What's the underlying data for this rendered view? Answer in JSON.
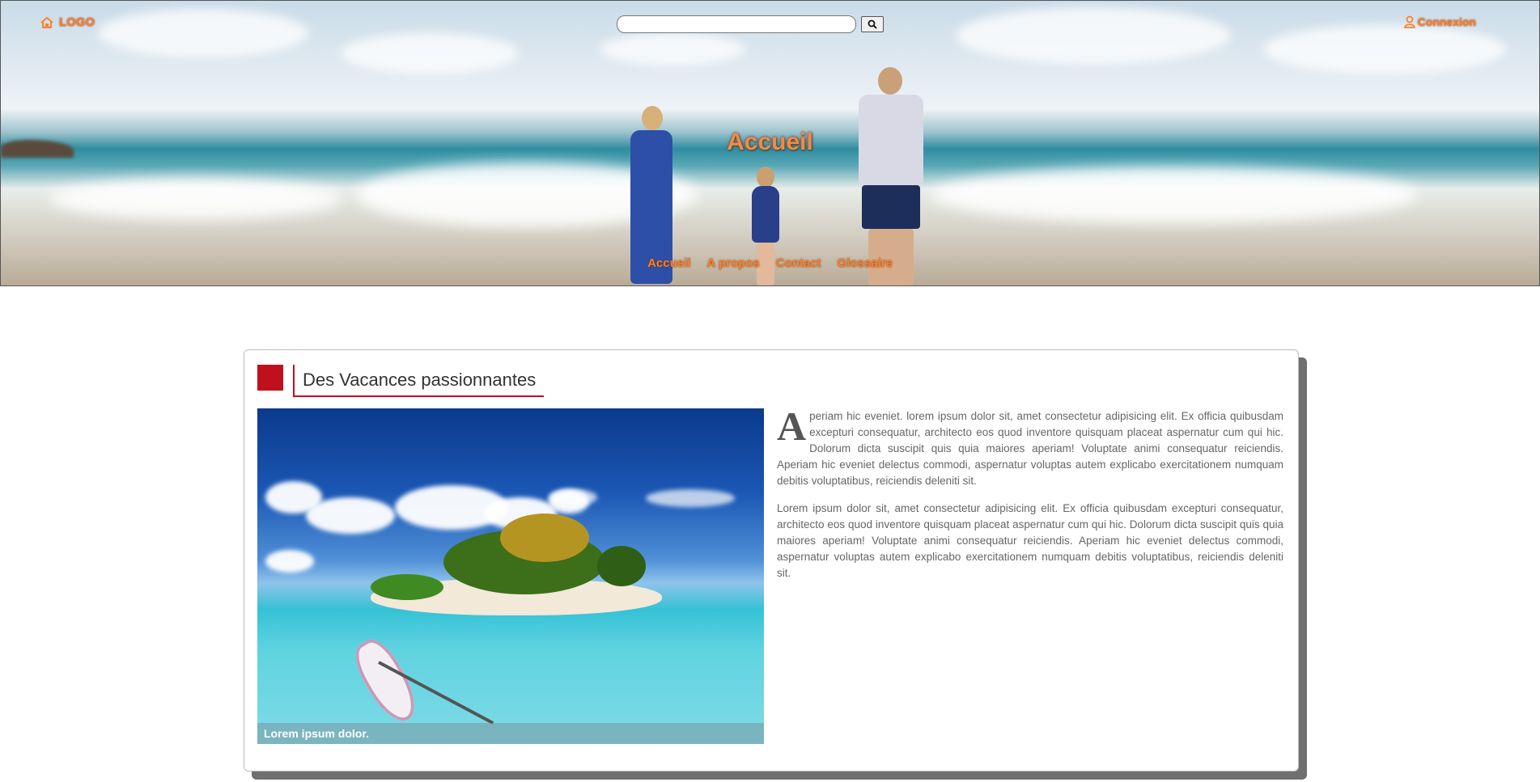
{
  "header": {
    "logo_label": "LOGO",
    "search": {
      "placeholder": "",
      "value": ""
    },
    "login_label": "Connexion",
    "title": "Accueil",
    "nav": [
      {
        "label": "Accueil"
      },
      {
        "label": "A propos"
      },
      {
        "label": "Contact"
      },
      {
        "label": "Glossaire"
      }
    ],
    "accent_color": "#ff7f2a"
  },
  "article": {
    "heading": "Des Vacances passionnantes",
    "accent_color": "#c0101c",
    "image_caption": "Lorem ipsum dolor.",
    "dropcap": "A",
    "paragraph1_rest": "periam hic eveniet. lorem ipsum dolor sit, amet consectetur adipisicing elit. Ex officia quibusdam excepturi consequatur, architecto eos quod inventore quisquam placeat aspernatur cum qui hic. Dolorum dicta suscipit quis quia maiores aperiam! Voluptate animi consequatur reiciendis. Aperiam hic eveniet delectus commodi, aspernatur voluptas autem explicabo exercitationem numquam debitis voluptatibus, reiciendis deleniti sit.",
    "paragraph2": "Lorem ipsum dolor sit, amet consectetur adipisicing elit. Ex officia quibusdam excepturi consequatur, architecto eos quod inventore quisquam placeat aspernatur cum qui hic. Dolorum dicta suscipit quis quia maiores aperiam! Voluptate animi consequatur reiciendis. Aperiam hic eveniet delectus commodi, aspernatur voluptas autem explicabo exercitationem numquam debitis voluptatibus, reiciendis deleniti sit."
  }
}
